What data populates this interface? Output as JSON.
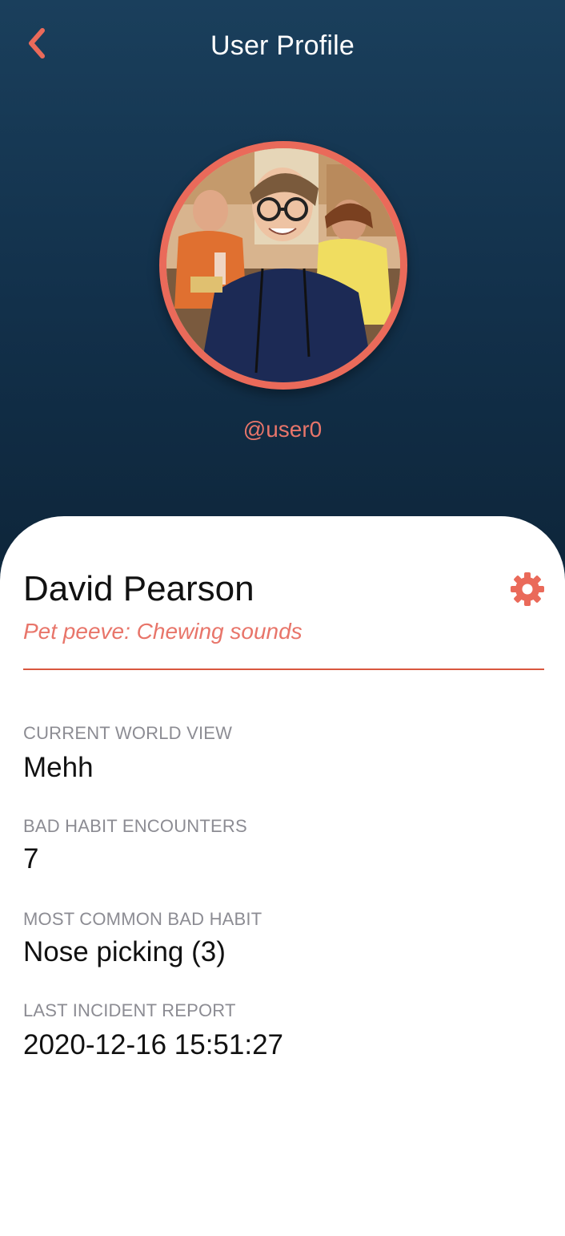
{
  "header": {
    "title": "User Profile",
    "back_icon": "chevron-left-icon",
    "accent_color": "#ea6a5a"
  },
  "profile": {
    "handle": "@user0",
    "avatar": "profile-photo",
    "name": "David Pearson",
    "pet_peeve": "Pet peeve: Chewing sounds",
    "settings_icon": "gear-icon"
  },
  "stats": [
    {
      "label": "CURRENT WORLD VIEW",
      "value": "Mehh"
    },
    {
      "label": "BAD HABIT ENCOUNTERS",
      "value": "7"
    },
    {
      "label": "MOST COMMON BAD HABIT",
      "value": "Nose picking (3)"
    },
    {
      "label": "LAST INCIDENT REPORT",
      "value": "2020-12-16 15:51:27"
    }
  ]
}
